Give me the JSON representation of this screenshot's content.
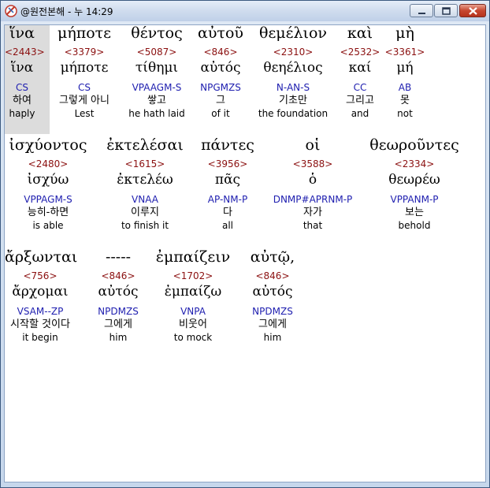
{
  "window": {
    "title": "@원전본해 - 누 14:29"
  },
  "lines": [
    {
      "words": [
        {
          "greek": "ἵνα",
          "strong": "<2443>",
          "lemma": "ἵνα",
          "morph": "CS",
          "korean": "하여",
          "english": "haply"
        },
        {
          "greek": "μήποτε",
          "strong": "<3379>",
          "lemma": "μήποτε",
          "morph": "CS",
          "korean": "그렇게 아니",
          "english": "Lest"
        },
        {
          "greek": "θέντος",
          "strong": "<5087>",
          "lemma": "τίθημι",
          "morph": "VPAAGM-S",
          "korean": "쌓고",
          "english": "he hath laid"
        },
        {
          "greek": "αὐτοῦ",
          "strong": "<846>",
          "lemma": "αὐτός",
          "morph": "NPGMZS",
          "korean": "그",
          "english": "of it"
        },
        {
          "greek": "θεμέλιον",
          "strong": "<2310>",
          "lemma": "θεηέλιος",
          "morph": "N-AN-S",
          "korean": "기초만",
          "english": "the foundation"
        },
        {
          "greek": "καὶ",
          "strong": "<2532>",
          "lemma": "καί",
          "morph": "CC",
          "korean": "그리고",
          "english": "and"
        },
        {
          "greek": "μὴ",
          "strong": "<3361>",
          "lemma": "μή",
          "morph": "AB",
          "korean": "못",
          "english": "not"
        }
      ]
    },
    {
      "words": [
        {
          "greek": "ἰσχύοντος",
          "strong": "<2480>",
          "lemma": "ἰσχύω",
          "morph": "VPPAGM-S",
          "korean": "능히-하면",
          "english": "is able"
        },
        {
          "greek": "ἐκτελέσαι",
          "strong": "<1615>",
          "lemma": "ἐκτελέω",
          "morph": "VNAA",
          "korean": "이루지",
          "english": "to finish it"
        },
        {
          "greek": "πάντες",
          "strong": "<3956>",
          "lemma": "πᾶς",
          "morph": "AP-NM-P",
          "korean": "다",
          "english": "all"
        },
        {
          "greek": "οἱ",
          "strong": "<3588>",
          "lemma": "ὁ",
          "morph": "DNMP#APRNM-P",
          "korean": "자가",
          "english": "that"
        },
        {
          "greek": "θεωροῦντες",
          "strong": "<2334>",
          "lemma": "θεωρέω",
          "morph": "VPPANM-P",
          "korean": "보는",
          "english": "behold"
        }
      ]
    },
    {
      "words": [
        {
          "greek": "ἄρξωνται",
          "strong": "<756>",
          "lemma": "ἄρχομαι",
          "morph": "VSAM--ZP",
          "korean": "시작할 것이다",
          "english": "it begin"
        },
        {
          "greek": "-----",
          "strong": "<846>",
          "lemma": "αὐτός",
          "morph": "NPDMZS",
          "korean": "그에게",
          "english": "him"
        },
        {
          "greek": "ἐμπαίζειν",
          "strong": "<1702>",
          "lemma": "ἐμπαίζω",
          "morph": "VNPA",
          "korean": "비웃어",
          "english": "to mock"
        },
        {
          "greek": "αὐτῷ,",
          "strong": "<846>",
          "lemma": "αὐτός",
          "morph": "NPDMZS",
          "korean": "그에게",
          "english": "him"
        }
      ]
    }
  ]
}
